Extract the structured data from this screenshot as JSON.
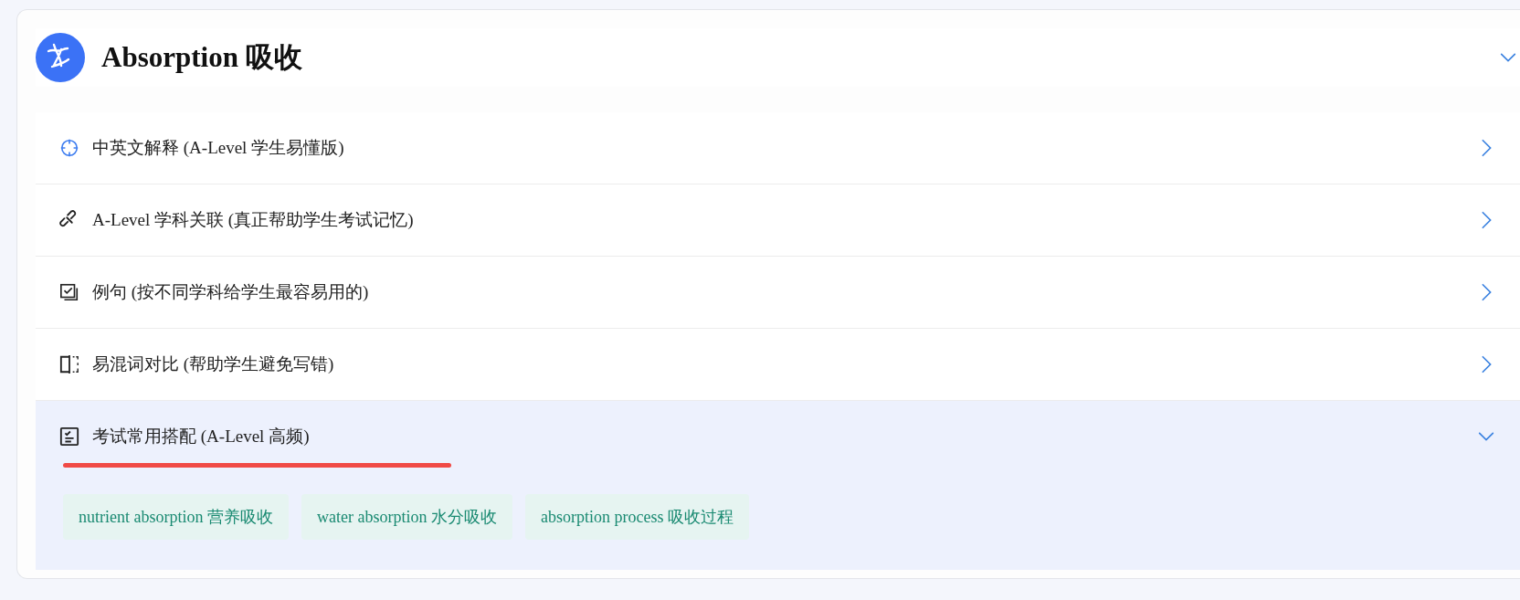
{
  "card": {
    "title": "Absorption 吸收",
    "expanded": true,
    "sections": [
      {
        "title": "中英文解释 (A-Level 学生易懂版)",
        "expanded": false
      },
      {
        "title": "A-Level 学科关联 (真正帮助学生考试记忆)",
        "expanded": false
      },
      {
        "title": "例句 (按不同学科给学生最容易用的)",
        "expanded": false
      },
      {
        "title": "易混词对比 (帮助学生避免写错)",
        "expanded": false
      },
      {
        "title": "考试常用搭配 (A-Level 高频)",
        "expanded": true,
        "tags": [
          "nutrient absorption 营养吸收",
          "water absorption 水分吸收",
          "absorption process 吸收过程"
        ]
      }
    ]
  }
}
